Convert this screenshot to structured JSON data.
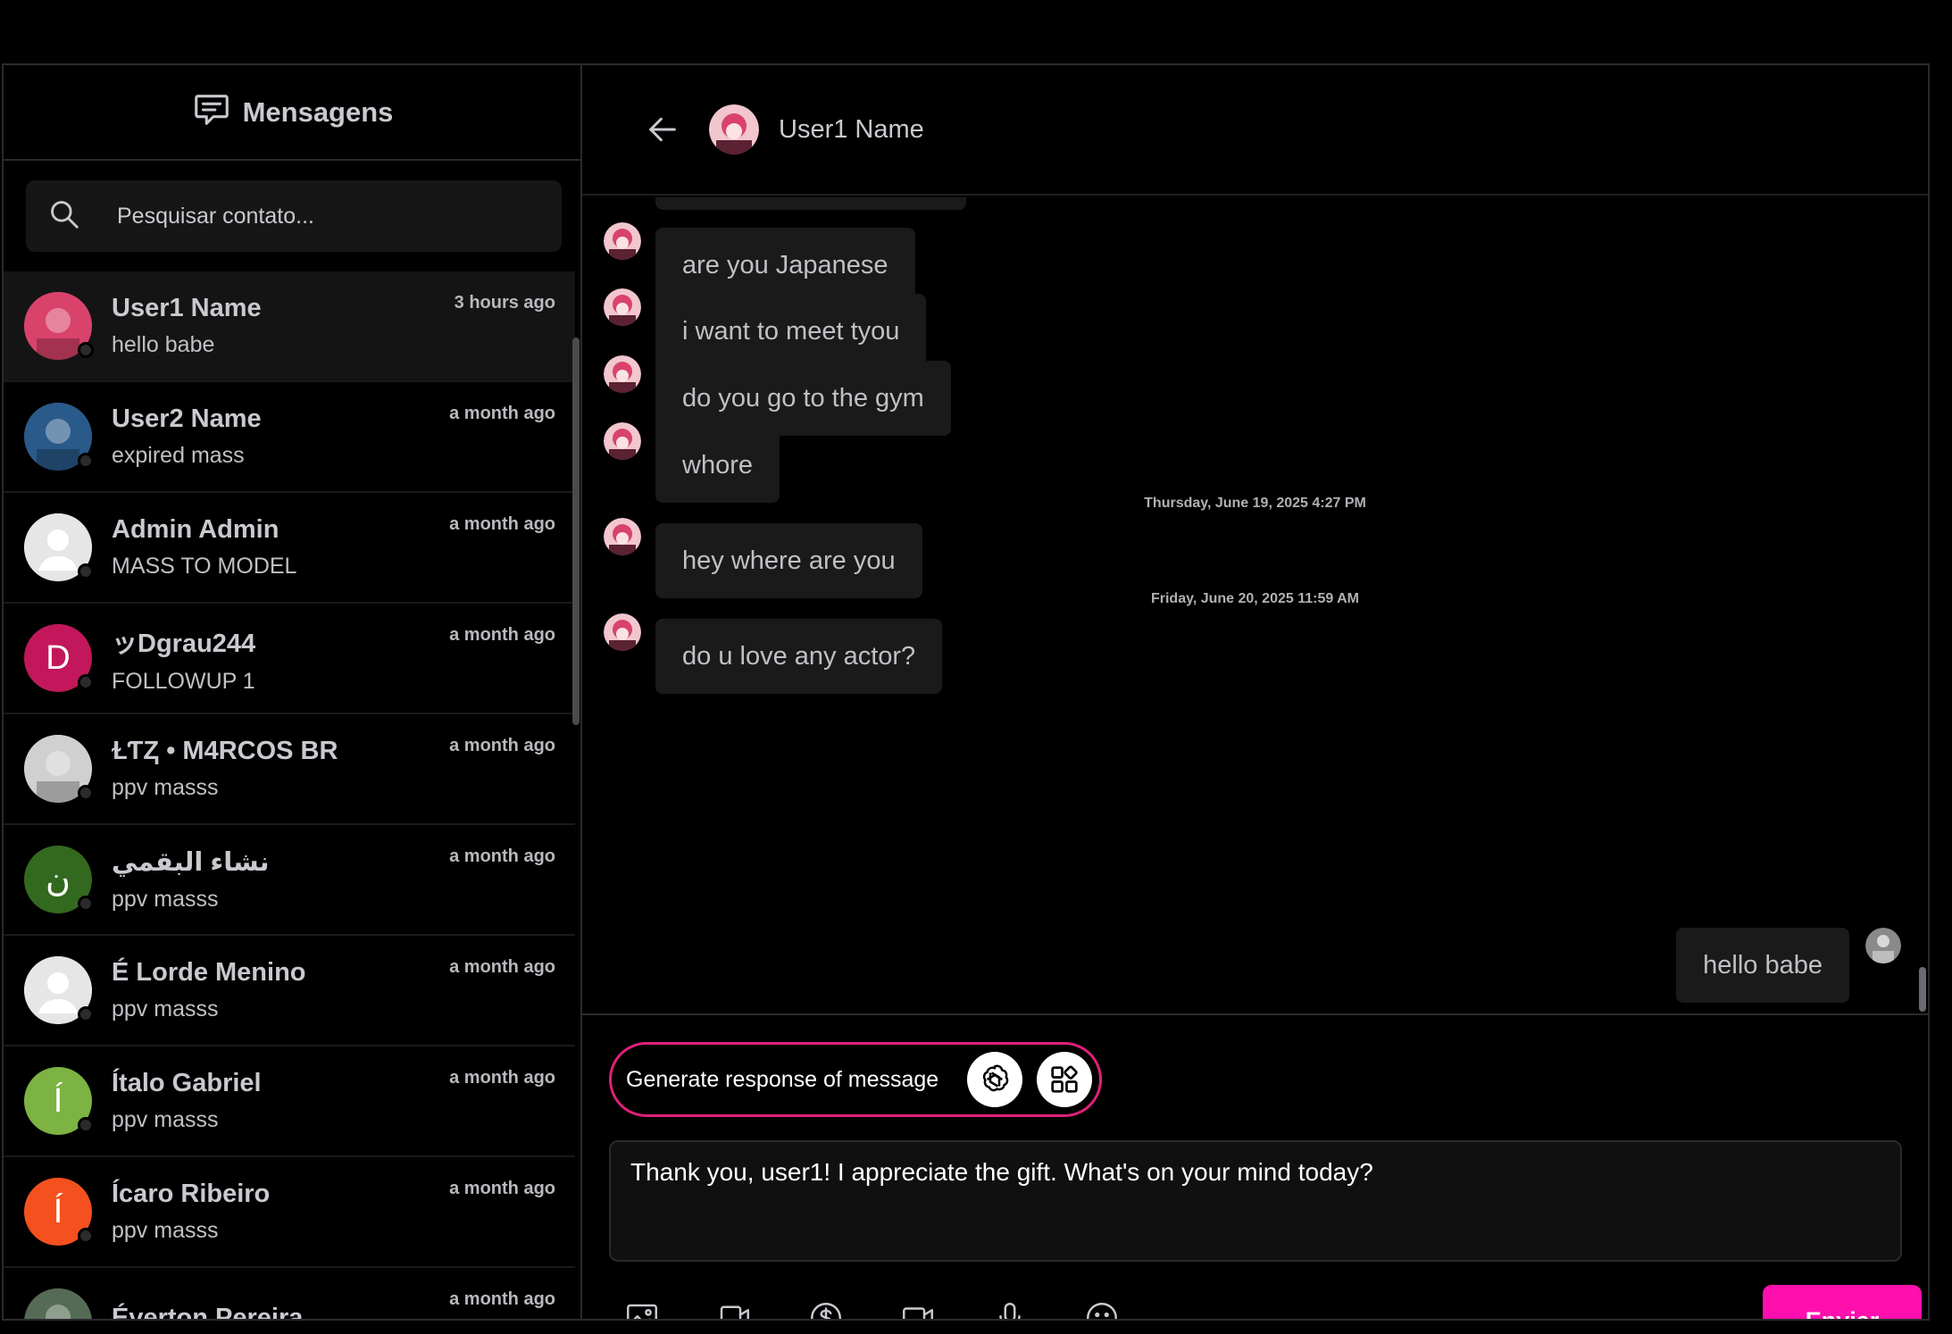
{
  "sidebar": {
    "title": "Mensagens",
    "search_placeholder": "Pesquisar contato...",
    "contacts": [
      {
        "name": "User1 Name",
        "last": "hello babe",
        "time": "3 hours ago",
        "initial": "",
        "color": "#d9436b"
      },
      {
        "name": "User2 Name",
        "last": "expired mass",
        "time": "a month ago",
        "initial": "",
        "color": "#2a5a8a"
      },
      {
        "name": "Admin Admin",
        "last": "MASS TO MODEL",
        "time": "a month ago",
        "initial": "",
        "color": "#e6e6e6"
      },
      {
        "name": "ッDgrau244",
        "last": "FOLLOWUP 1",
        "time": "a month ago",
        "initial": "D",
        "color": "#c2185b"
      },
      {
        "name": "ⱢƬⱫ • M4RCOS BR",
        "last": "ppv masss",
        "time": "a month ago",
        "initial": "",
        "color": "#d0d0d0"
      },
      {
        "name": "نشاء البقمي",
        "last": "ppv masss",
        "time": "a month ago",
        "initial": "ن",
        "color": "#33691e"
      },
      {
        "name": "É Lorde Menino",
        "last": "ppv masss",
        "time": "a month ago",
        "initial": "",
        "color": "#e6e6e6"
      },
      {
        "name": "Ítalo Gabriel",
        "last": "ppv masss",
        "time": "a month ago",
        "initial": "Í",
        "color": "#7cb342"
      },
      {
        "name": "Ícaro Ribeiro",
        "last": "ppv masss",
        "time": "a month ago",
        "initial": "Í",
        "color": "#f4511e"
      },
      {
        "name": "Éverton Pereira",
        "last": "",
        "time": "a month ago",
        "initial": "",
        "color": "#556b55"
      }
    ]
  },
  "chat": {
    "contact_name": "User1 Name",
    "messages": [
      {
        "text": "are you Japanese"
      },
      {
        "text": "i want to meet tyou"
      },
      {
        "text": "do you go to the gym"
      },
      {
        "text": "whore"
      },
      {
        "text": "hey where are you"
      },
      {
        "text": "do u love any actor?"
      }
    ],
    "date_separators": [
      "Thursday, June 19, 2025 4:27 PM",
      "Friday, June 20, 2025 11:59 AM"
    ],
    "own_message": "hello babe"
  },
  "composer": {
    "generate_label": "Generate response of message",
    "draft": "Thank you, user1! I appreciate the gift. What's on your mind today?",
    "send_label": "Enviar",
    "tools": [
      "image-icon",
      "screen-share-icon",
      "dollar-icon",
      "video-icon",
      "microphone-icon",
      "emoji-icon"
    ]
  },
  "colors": {
    "accent": "#ff0fae",
    "pill_border": "#e0207a",
    "background": "#000000"
  }
}
